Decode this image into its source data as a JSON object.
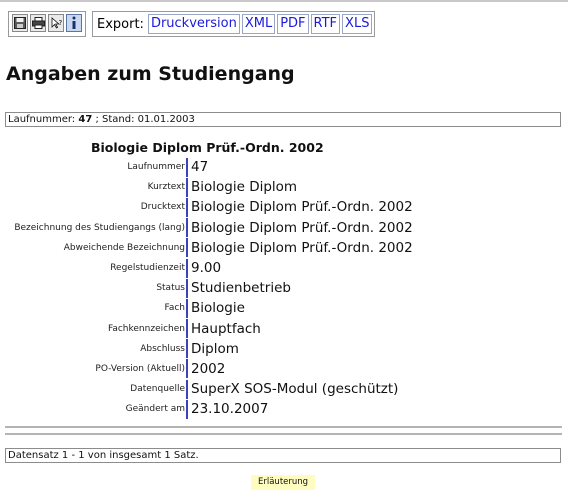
{
  "toolbar": {
    "icons": [
      "save-icon",
      "print-icon",
      "help-query-icon",
      "info-icon"
    ],
    "export_label": "Export:",
    "export_links": [
      "Druckversion",
      "XML",
      "PDF",
      "RTF",
      "XLS"
    ]
  },
  "page_title": "Angaben zum Studiengang",
  "info_bar": {
    "prefix": "Laufnummer: ",
    "number": "47",
    "suffix": " ; Stand: 01.01.2003"
  },
  "record_title": "Biologie Diplom Prüf.-Ordn. 2002",
  "fields": [
    {
      "label": "Laufnummer",
      "value": "47"
    },
    {
      "label": "Kurztext",
      "value": "Biologie Diplom"
    },
    {
      "label": "Drucktext",
      "value": "Biologie Diplom Prüf.-Ordn. 2002"
    },
    {
      "label": "Bezeichnung des Studiengangs (lang)",
      "value": "Biologie Diplom Prüf.-Ordn. 2002"
    },
    {
      "label": "Abweichende Bezeichnung",
      "value": "Biologie Diplom Prüf.-Ordn. 2002"
    },
    {
      "label": "Regelstudienzeit",
      "value": "9.00"
    },
    {
      "label": "Status",
      "value": "Studienbetrieb"
    },
    {
      "label": "Fach",
      "value": "Biologie"
    },
    {
      "label": "Fachkennzeichen",
      "value": "Hauptfach"
    },
    {
      "label": "Abschluss",
      "value": "Diplom"
    },
    {
      "label": "PO-Version (Aktuell)",
      "value": "2002"
    },
    {
      "label": "Datenquelle",
      "value": "SuperX SOS-Modul (geschützt)"
    },
    {
      "label": "Geändert am",
      "value": "23.10.2007"
    }
  ],
  "footer_text": "Datensatz 1 - 1 von insgesamt 1 Satz.",
  "explain_button": "Erläuterung",
  "colors": {
    "link": "#1a1adc",
    "field_separator": "#3a44b8",
    "button_bg": "#fffcc0"
  }
}
